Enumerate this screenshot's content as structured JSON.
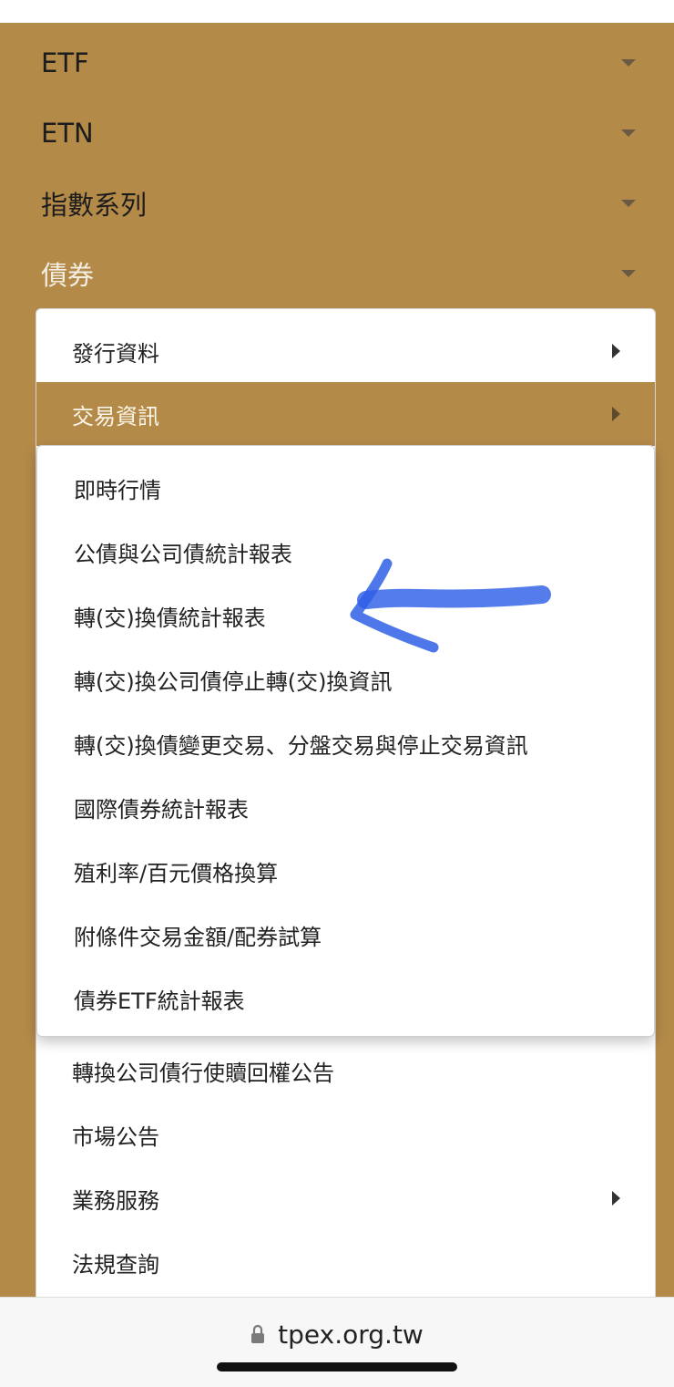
{
  "nav": {
    "items": [
      {
        "label": "ETF"
      },
      {
        "label": "ETN"
      },
      {
        "label": "指數系列"
      },
      {
        "label": "債券"
      }
    ]
  },
  "submenu_l1": {
    "items": [
      {
        "label": "發行資料",
        "has_children": true
      },
      {
        "label": "交易資訊",
        "has_children": true,
        "active": true
      },
      {
        "label": "轉換公司債行使贖回權公告",
        "has_children": false
      },
      {
        "label": "市場公告",
        "has_children": false
      },
      {
        "label": "業務服務",
        "has_children": true
      },
      {
        "label": "法規查詢",
        "has_children": false
      }
    ]
  },
  "submenu_l2": {
    "items": [
      {
        "label": "即時行情"
      },
      {
        "label": "公債與公司債統計報表"
      },
      {
        "label": "轉(交)換債統計報表"
      },
      {
        "label": "轉(交)換公司債停止轉(交)換資訊"
      },
      {
        "label": "轉(交)換債變更交易、分盤交易與停止交易資訊"
      },
      {
        "label": "國際債券統計報表"
      },
      {
        "label": "殖利率/百元價格換算"
      },
      {
        "label": "附條件交易金額/配券試算"
      },
      {
        "label": "債券ETF統計報表"
      }
    ]
  },
  "browser": {
    "url": "tpex.org.tw",
    "lock_icon": "lock-icon"
  },
  "colors": {
    "brand_gold": "#b48a49",
    "annotation_blue": "#2f5fe6"
  }
}
